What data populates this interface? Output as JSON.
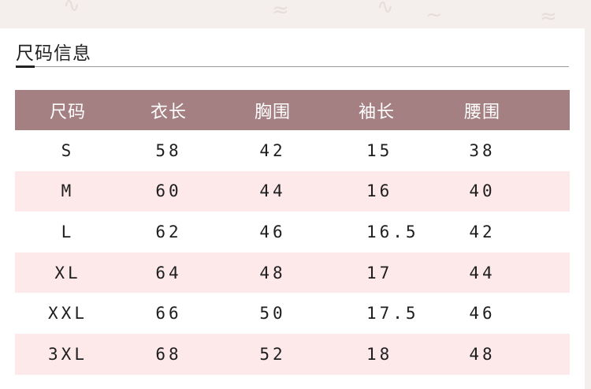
{
  "section": {
    "title": "尺码信息"
  },
  "table": {
    "columns": [
      "尺码",
      "衣长",
      "胸围",
      "袖长",
      "腰围"
    ],
    "rows": [
      [
        "S",
        "58",
        "42",
        "15",
        "38"
      ],
      [
        "M",
        "60",
        "44",
        "16",
        "40"
      ],
      [
        "L",
        "62",
        "46",
        "16.5",
        "42"
      ],
      [
        "XL",
        "64",
        "48",
        "17",
        "44"
      ],
      [
        "XXL",
        "66",
        "50",
        "17.5",
        "46"
      ],
      [
        "3XL",
        "68",
        "52",
        "18",
        "48"
      ]
    ]
  },
  "colors": {
    "header_bg": "#a58083",
    "stripe_bg": "#fde8ea",
    "page_bg": "#f4eeec"
  }
}
